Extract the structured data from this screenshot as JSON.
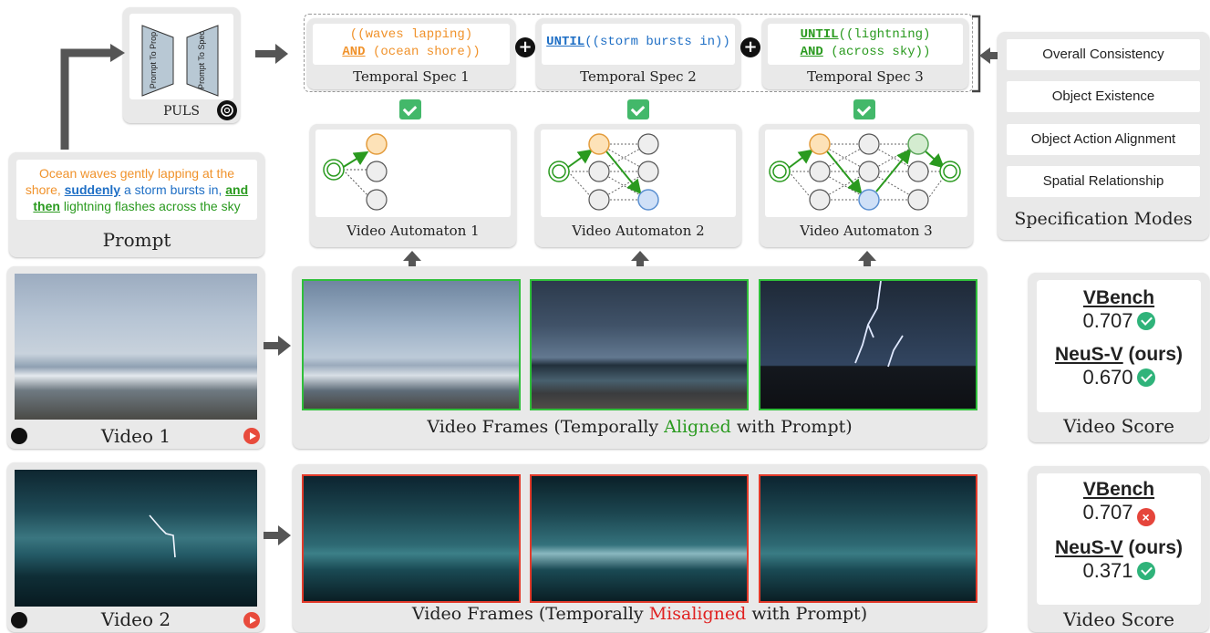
{
  "puls": {
    "label": "PULS",
    "box_left": "Prompt To Prop",
    "box_right": "Prompt To Spec"
  },
  "prompt": {
    "caption": "Prompt",
    "text_orange": "Ocean waves gently lapping at the shore,",
    "kw_suddenly": "suddenly",
    "text_blue": "a storm bursts in,",
    "kw_and": "and",
    "kw_then": "then",
    "text_green": "lightning flashes across the sky"
  },
  "specs": [
    {
      "caption": "Temporal Spec 1",
      "line1": "((waves lapping)",
      "kw": "AND",
      "line2": "(ocean shore))"
    },
    {
      "caption": "Temporal Spec 2",
      "kw": "UNTIL",
      "line1": "((storm bursts in))"
    },
    {
      "caption": "Temporal Spec 3",
      "kw": "UNTIL",
      "line1": "((lightning)",
      "kw2": "AND",
      "line2": "(across sky))"
    }
  ],
  "automata": [
    {
      "caption": "Video Automaton 1"
    },
    {
      "caption": "Video Automaton 2"
    },
    {
      "caption": "Video Automaton 3"
    }
  ],
  "modes": {
    "caption": "Specification Modes",
    "items": [
      "Overall Consistency",
      "Object Existence",
      "Object Action Alignment",
      "Spatial Relationship"
    ]
  },
  "video1": {
    "caption": "Video 1",
    "frames_caption_pre": "Video Frames (Temporally ",
    "frames_caption_word": "Aligned",
    "frames_caption_post": " with Prompt)",
    "score": {
      "vbench_label": "VBench",
      "vbench": "0.707",
      "neusv_label": "NeuS-V",
      "neusv_suffix": "(ours)",
      "neusv": "0.670",
      "caption": "Video Score"
    }
  },
  "video2": {
    "caption": "Video 2",
    "frames_caption_pre": "Video Frames (Temporally ",
    "frames_caption_word": "Misaligned",
    "frames_caption_post": " with Prompt)",
    "score": {
      "vbench_label": "VBench",
      "vbench": "0.707",
      "neusv_label": "NeuS-V",
      "neusv_suffix": "(ours)",
      "neusv": "0.371",
      "caption": "Video Score"
    }
  },
  "colors": {
    "aligned": "#2a9a1f",
    "misaligned": "#e02020",
    "accent_orange": "#f0922b",
    "accent_blue": "#1f6fc5"
  }
}
